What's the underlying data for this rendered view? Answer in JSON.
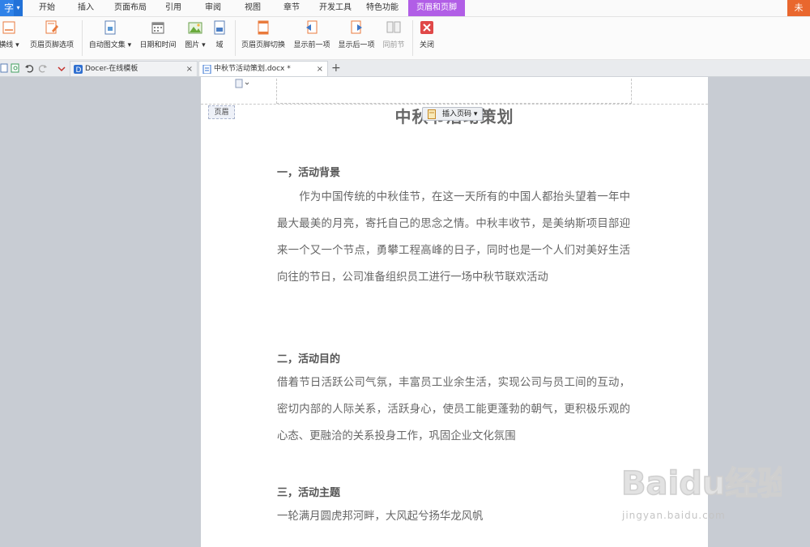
{
  "app": {
    "name_fragment": "字"
  },
  "menu_tabs": [
    {
      "label": "开始"
    },
    {
      "label": "插入"
    },
    {
      "label": "页面布局"
    },
    {
      "label": "引用"
    },
    {
      "label": "审阅"
    },
    {
      "label": "视图"
    },
    {
      "label": "章节"
    },
    {
      "label": "开发工具"
    },
    {
      "label": "特色功能"
    },
    {
      "label": "页眉和页脚"
    }
  ],
  "corner_label": "未",
  "ribbon": {
    "buttons": [
      {
        "label": "横线 ▾"
      },
      {
        "label": "页眉页脚选项"
      },
      {
        "label": "自动图文集 ▾"
      },
      {
        "label": "日期和时间"
      },
      {
        "label": "图片 ▾"
      },
      {
        "label": "域"
      },
      {
        "label": "页眉页脚切换"
      },
      {
        "label": "显示前一项"
      },
      {
        "label": "显示后一项"
      },
      {
        "label": "同前节"
      },
      {
        "label": "关闭"
      }
    ],
    "group_mark": "G"
  },
  "doc_tabs": [
    {
      "label": "Docer-在线模板",
      "close": "×"
    },
    {
      "label": "中秋节活动策划.docx *",
      "close": "×"
    }
  ],
  "new_tab": "+",
  "page": {
    "header_tag": "页眉",
    "insert_page_number": "插入页码 ▾",
    "title": "中秋节活动策划",
    "sections": [
      {
        "heading": "一，活动背景",
        "body": "　　作为中国传统的中秋佳节，在这一天所有的中国人都抬头望着一年中最大最美的月亮，寄托自己的思念之情。中秋丰收节，是美纳斯项目部迎来一个又一个节点，勇攀工程高峰的日子，同时也是一个人们对美好生活向往的节日，公司准备组织员工进行一场中秋节联欢活动"
      },
      {
        "heading": "二，活动目的",
        "body": "借着节日活跃公司气氛，丰富员工业余生活，实现公司与员工间的互动，密切内部的人际关系，活跃身心，使员工能更蓬勃的朝气，更积极乐观的心态、更融洽的关系投身工作，巩固企业文化氛围"
      },
      {
        "heading": "三，活动主题",
        "body": "一轮满月圆虎邦河畔，大风起兮扬华龙风帆"
      }
    ]
  },
  "watermark": {
    "text": "jingyan.baidu.com",
    "brand": "Baidu经验"
  },
  "colors": {
    "accent_tab": "#b15ee6",
    "app_blue": "#2f82e8",
    "close_red": "#e04848"
  }
}
